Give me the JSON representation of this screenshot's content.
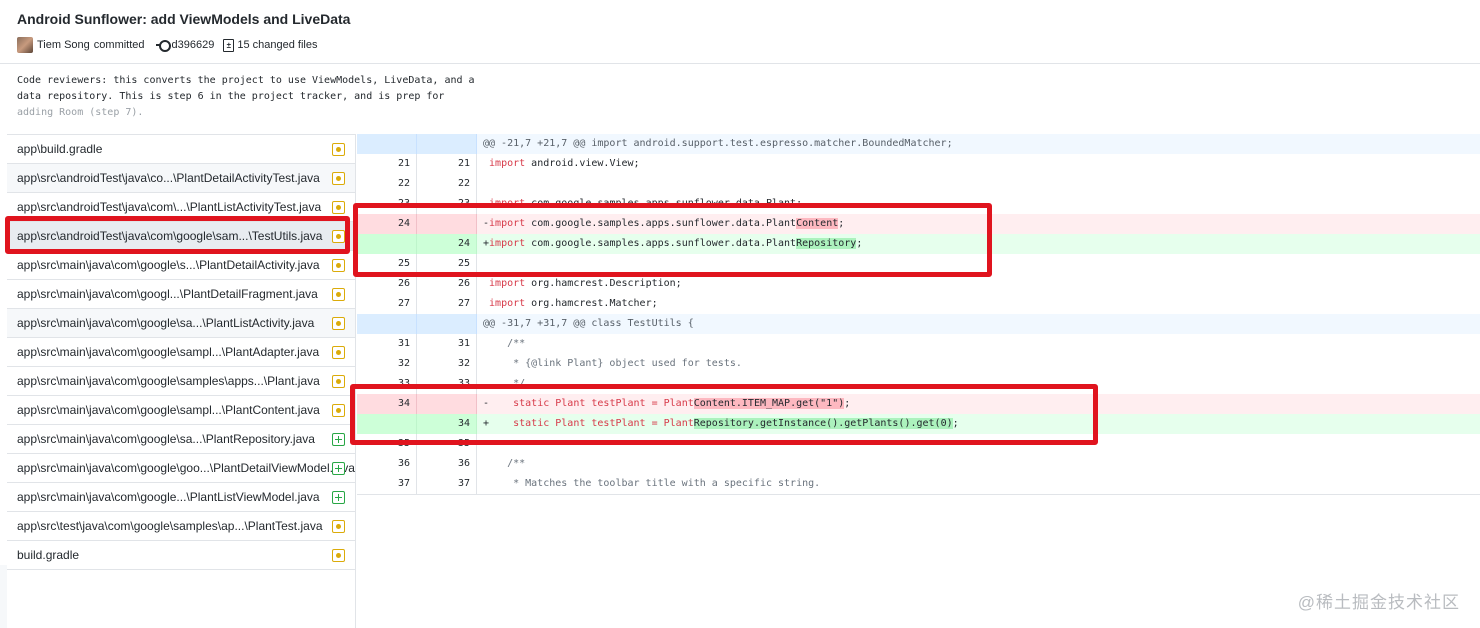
{
  "commit": {
    "title": "Android Sunflower: add ViewModels and LiveData",
    "author": "Tiem Song",
    "author_action": "committed",
    "sha": "d396629",
    "changed_files": "15 changed files",
    "description_lines": [
      "Code reviewers: this converts the project to use ViewModels, LiveData, and a",
      "data repository. This is step 6 in the project tracker, and is prep for",
      "adding Room (step 7)."
    ]
  },
  "files": [
    {
      "path": "app\\build.gradle",
      "status": "modified"
    },
    {
      "path": "app\\src\\androidTest\\java\\co...\\PlantDetailActivityTest.java",
      "status": "modified"
    },
    {
      "path": "app\\src\\androidTest\\java\\com\\...\\PlantListActivityTest.java",
      "status": "modified"
    },
    {
      "path": "app\\src\\androidTest\\java\\com\\google\\sam...\\TestUtils.java",
      "status": "modified",
      "selected": true
    },
    {
      "path": "app\\src\\main\\java\\com\\google\\s...\\PlantDetailActivity.java",
      "status": "modified"
    },
    {
      "path": "app\\src\\main\\java\\com\\googl...\\PlantDetailFragment.java",
      "status": "modified"
    },
    {
      "path": "app\\src\\main\\java\\com\\google\\sa...\\PlantListActivity.java",
      "status": "modified"
    },
    {
      "path": "app\\src\\main\\java\\com\\google\\sampl...\\PlantAdapter.java",
      "status": "modified"
    },
    {
      "path": "app\\src\\main\\java\\com\\google\\samples\\apps...\\Plant.java",
      "status": "modified"
    },
    {
      "path": "app\\src\\main\\java\\com\\google\\sampl...\\PlantContent.java",
      "status": "modified"
    },
    {
      "path": "app\\src\\main\\java\\com\\google\\sa...\\PlantRepository.java",
      "status": "added"
    },
    {
      "path": "app\\src\\main\\java\\com\\google\\goo...\\PlantDetailViewModel.java",
      "status": "added"
    },
    {
      "path": "app\\src\\main\\java\\com\\google...\\PlantListViewModel.java",
      "status": "added"
    },
    {
      "path": "app\\src\\test\\java\\com\\google\\samples\\ap...\\PlantTest.java",
      "status": "modified"
    },
    {
      "path": "build.gradle",
      "status": "modified"
    }
  ],
  "diff": {
    "hunk1": "@@ -21,7 +21,7 @@ import android.support.test.espresso.matcher.BoundedMatcher;",
    "hunk2": "@@ -31,7 +31,7 @@ class TestUtils {",
    "lines": [
      {
        "old": "21",
        "new": "21",
        "sign": " ",
        "kw": "import",
        "rest": " android.view.View;"
      },
      {
        "old": "22",
        "new": "22",
        "sign": " ",
        "kw": "",
        "rest": ""
      },
      {
        "old": "23",
        "new": "23",
        "sign": " ",
        "kw": "import",
        "rest": " com.google.samples.apps.sunflower.data.Plant;"
      },
      {
        "old": "24",
        "new": "",
        "sign": "-",
        "kw": "import",
        "rest": " com.google.samples.apps.sunflower.data.Plant",
        "hl": "Content",
        "tail": ";"
      },
      {
        "old": "",
        "new": "24",
        "sign": "+",
        "kw": "import",
        "rest": " com.google.samples.apps.sunflower.data.Plant",
        "hl": "Repository",
        "tail": ";"
      },
      {
        "old": "25",
        "new": "25",
        "sign": " ",
        "kw": "",
        "rest": ""
      },
      {
        "old": "26",
        "new": "26",
        "sign": " ",
        "kw": "import",
        "rest": " org.hamcrest.Description;"
      },
      {
        "old": "27",
        "new": "27",
        "sign": " ",
        "kw": "import",
        "rest": " org.hamcrest.Matcher;"
      },
      {
        "old": "31",
        "new": "31",
        "sign": " ",
        "text": "    /**"
      },
      {
        "old": "32",
        "new": "32",
        "sign": " ",
        "text": "     * {@link Plant} object used for tests."
      },
      {
        "old": "33",
        "new": "33",
        "sign": " ",
        "text": "     */"
      },
      {
        "old": "34",
        "new": "",
        "sign": "-",
        "pre": "    static Plant testPlant = Plant",
        "hl": "Content.ITEM_MAP.get(\"1\")",
        "tail": ";"
      },
      {
        "old": "",
        "new": "34",
        "sign": "+",
        "pre": "    static Plant testPlant = Plant",
        "hl": "Repository.getInstance().getPlants().get(0)",
        "tail": ";"
      },
      {
        "old": "35",
        "new": "35",
        "sign": " ",
        "text": ""
      },
      {
        "old": "36",
        "new": "36",
        "sign": " ",
        "text": "    /**"
      },
      {
        "old": "37",
        "new": "37",
        "sign": " ",
        "text": "     * Matches the toolbar title with a specific string."
      }
    ]
  },
  "watermark": "@稀土掘金技术社区",
  "colors": {
    "annotation_red": "#e0141e",
    "modified": "#dbab09",
    "added": "#28a745"
  }
}
